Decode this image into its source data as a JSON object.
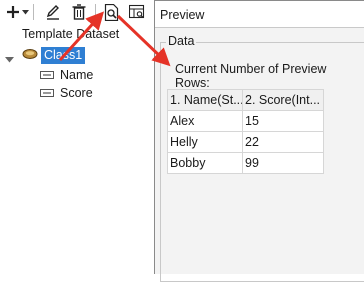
{
  "tree": {
    "title": "Template Dataset",
    "class_name": "Class1",
    "fields": [
      "Name",
      "Score"
    ]
  },
  "toolbar": {
    "icons": [
      "add-icon",
      "dropdown-icon",
      "edit-icon",
      "delete-icon",
      "preview-icon",
      "table-preview-icon"
    ]
  },
  "preview": {
    "title": "Preview",
    "group_label": "Data",
    "rows_label": "Current Number of Preview Rows:",
    "columns": [
      "1. Name(St...",
      "2. Score(Int..."
    ],
    "rows": [
      [
        "Alex",
        "15"
      ],
      [
        "Helly",
        "22"
      ],
      [
        "Bobby",
        "99"
      ]
    ]
  },
  "colors": {
    "selection": "#2f7fd3",
    "arrow": "#e53327"
  }
}
